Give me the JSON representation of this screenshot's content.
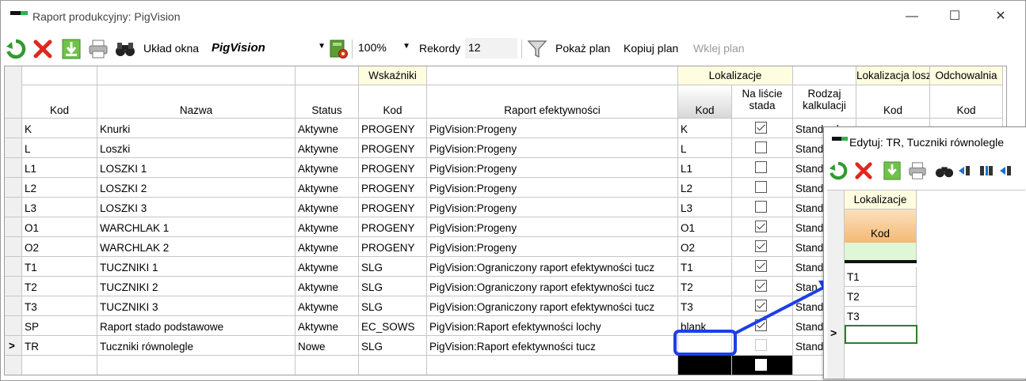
{
  "window": {
    "title": "Raport produkcyjny: PigVision",
    "minimize": "—",
    "maximize": "☐",
    "close": "✕"
  },
  "toolbar": {
    "layout_label": "Układ okna",
    "layout_value": "PigVision",
    "zoom_value": "100%",
    "records_label": "Rekordy",
    "records_value": "12",
    "show_plan": "Pokaż plan",
    "copy_plan": "Kopiuj plan",
    "paste_plan": "Wklej plan"
  },
  "grid": {
    "groups": {
      "indicators": "Wskaźniki",
      "locations": "Lokalizacje",
      "sow_locations": "Lokalizacja losze",
      "rearing": "Odchowalnia"
    },
    "columns": {
      "kod": "Kod",
      "nazwa": "Nazwa",
      "status": "Status",
      "ind_kod": "Kod",
      "raport": "Raport efektywności",
      "lok_kod": "Kod",
      "na_liscie_1": "Na liście",
      "na_liscie_2": "stada",
      "rodzaj_1": "Rodzaj",
      "rodzaj_2": "kalkulacji",
      "sow_kod": "Kod",
      "rear_kod": "Kod"
    },
    "rows": [
      {
        "marker": "",
        "kod": "K",
        "nazwa": "Knurki",
        "status": "Aktywne",
        "ind": "PROGENY",
        "raport": "PigVision:Progeny",
        "lok": "K",
        "checked": true,
        "rodzaj": "Standard"
      },
      {
        "marker": "",
        "kod": "L",
        "nazwa": "Loszki",
        "status": "Aktywne",
        "ind": "PROGENY",
        "raport": "PigVision:Progeny",
        "lok": "L",
        "checked": false,
        "rodzaj": "Stand"
      },
      {
        "marker": "",
        "kod": "L1",
        "nazwa": "LOSZKI 1",
        "status": "Aktywne",
        "ind": "PROGENY",
        "raport": "PigVision:Progeny",
        "lok": "L1",
        "checked": false,
        "rodzaj": "Stand"
      },
      {
        "marker": "",
        "kod": "L2",
        "nazwa": "LOSZKI 2",
        "status": "Aktywne",
        "ind": "PROGENY",
        "raport": "PigVision:Progeny",
        "lok": "L2",
        "checked": false,
        "rodzaj": "Stand"
      },
      {
        "marker": "",
        "kod": "L3",
        "nazwa": "LOSZKI 3",
        "status": "Aktywne",
        "ind": "PROGENY",
        "raport": "PigVision:Progeny",
        "lok": "L3",
        "checked": false,
        "rodzaj": "Stand"
      },
      {
        "marker": "",
        "kod": "O1",
        "nazwa": "WARCHLAK 1",
        "status": "Aktywne",
        "ind": "PROGENY",
        "raport": "PigVision:Progeny",
        "lok": "O1",
        "checked": true,
        "rodzaj": "Stand"
      },
      {
        "marker": "",
        "kod": "O2",
        "nazwa": "WARCHLAK 2",
        "status": "Aktywne",
        "ind": "PROGENY",
        "raport": "PigVision:Progeny",
        "lok": "O2",
        "checked": true,
        "rodzaj": "Stand"
      },
      {
        "marker": "",
        "kod": "T1",
        "nazwa": "TUCZNIKI 1",
        "status": "Aktywne",
        "ind": "SLG",
        "raport": "PigVision:Ograniczony raport efektywności tucz",
        "lok": "T1",
        "checked": true,
        "rodzaj": "Stand"
      },
      {
        "marker": "",
        "kod": "T2",
        "nazwa": "TUCZNIKI 2",
        "status": "Aktywne",
        "ind": "SLG",
        "raport": "PigVision:Ograniczony raport efektywności tucz",
        "lok": "T2",
        "checked": true,
        "rodzaj": "Stan"
      },
      {
        "marker": "",
        "kod": "T3",
        "nazwa": "TUCZNIKI 3",
        "status": "Aktywne",
        "ind": "SLG",
        "raport": "PigVision:Ograniczony raport efektywności tucz",
        "lok": "T3",
        "checked": true,
        "rodzaj": "Stand"
      },
      {
        "marker": "",
        "kod": "SP",
        "nazwa": "Raport stado podstawowe",
        "status": "Aktywne",
        "ind": "EC_SOWS",
        "raport": "PigVision:Raport efektywności lochy",
        "lok": "blank",
        "checked": true,
        "rodzaj": "Stand"
      },
      {
        "marker": ">",
        "kod": "TR",
        "nazwa": "Tuczniki równolegle",
        "status": "Nowe",
        "ind": "SLG",
        "raport": "PigVision:Raport efektywności tucz",
        "lok": "",
        "checked": false,
        "rodzaj": "Stand"
      }
    ]
  },
  "popup": {
    "title": "Edytuj: TR, Tuczniki równolegle",
    "group": "Lokalizacje",
    "column": "Kod",
    "rows": [
      "T1",
      "T2",
      "T3"
    ],
    "new_marker": ">"
  },
  "colors": {
    "accent_blue": "#1d3fe6",
    "header_yellow": "#fffde0",
    "sorted_header_orange": "#f7c98f",
    "new_row_green": "#dff7d6"
  }
}
